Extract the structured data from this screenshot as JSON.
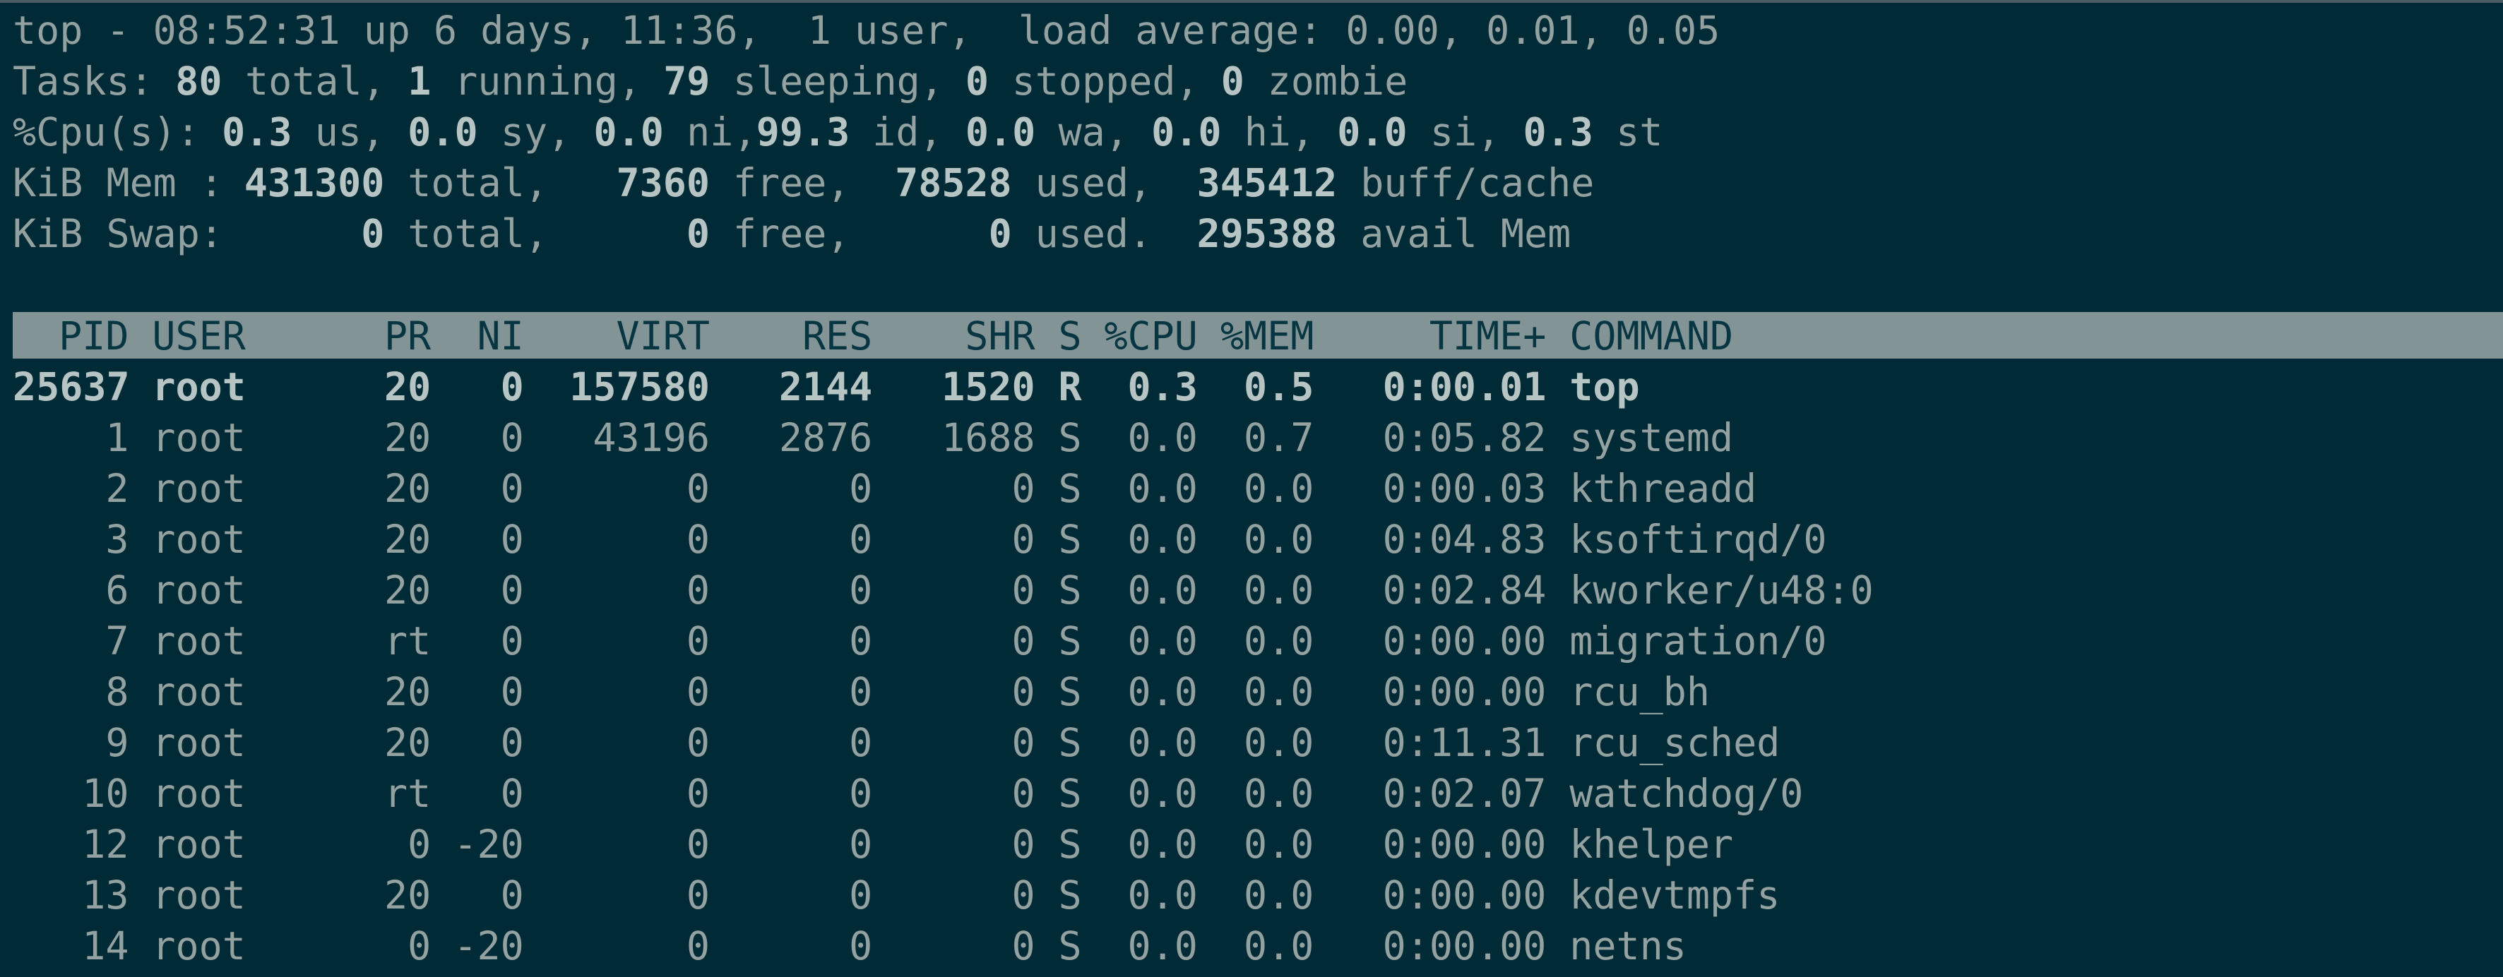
{
  "summary": {
    "line1": "top - 08:52:31 up 6 days, 11:36,  1 user,  load average: 0.00, 0.01, 0.05",
    "tasks": {
      "label": "Tasks:",
      "total": "80",
      "total_lbl": "total,",
      "running": "1",
      "running_lbl": "running,",
      "sleeping": "79",
      "sleeping_lbl": "sleeping,",
      "stopped": "0",
      "stopped_lbl": "stopped,",
      "zombie": "0",
      "zombie_lbl": "zombie"
    },
    "cpu": {
      "label": "%Cpu(s):",
      "us": "0.3",
      "us_lbl": "us,",
      "sy": "0.0",
      "sy_lbl": "sy,",
      "ni": "0.0",
      "ni_lbl": "ni,",
      "id": "99.3",
      "id_lbl": "id,",
      "wa": "0.0",
      "wa_lbl": "wa,",
      "hi": "0.0",
      "hi_lbl": "hi,",
      "si": "0.0",
      "si_lbl": "si,",
      "st": "0.3",
      "st_lbl": "st"
    },
    "mem": {
      "label": "KiB Mem :",
      "total": "431300",
      "total_lbl": "total,",
      "free": "7360",
      "free_lbl": "free,",
      "used": "78528",
      "used_lbl": "used,",
      "buff": "345412",
      "buff_lbl": "buff/cache"
    },
    "swap": {
      "label": "KiB Swap:",
      "total": "0",
      "total_lbl": "total,",
      "free": "0",
      "free_lbl": "free,",
      "used": "0",
      "used_lbl": "used.",
      "avail": "295388",
      "avail_lbl": "avail Mem"
    }
  },
  "columns": [
    "PID",
    "USER",
    "PR",
    "NI",
    "VIRT",
    "RES",
    "SHR",
    "S",
    "%CPU",
    "%MEM",
    "TIME+",
    "COMMAND"
  ],
  "processes": [
    [
      "25637",
      "root",
      "20",
      "0",
      "157580",
      "2144",
      "1520",
      "R",
      "0.3",
      "0.5",
      "0:00.01",
      "top"
    ],
    [
      "1",
      "root",
      "20",
      "0",
      "43196",
      "2876",
      "1688",
      "S",
      "0.0",
      "0.7",
      "0:05.82",
      "systemd"
    ],
    [
      "2",
      "root",
      "20",
      "0",
      "0",
      "0",
      "0",
      "S",
      "0.0",
      "0.0",
      "0:00.03",
      "kthreadd"
    ],
    [
      "3",
      "root",
      "20",
      "0",
      "0",
      "0",
      "0",
      "S",
      "0.0",
      "0.0",
      "0:04.83",
      "ksoftirqd/0"
    ],
    [
      "6",
      "root",
      "20",
      "0",
      "0",
      "0",
      "0",
      "S",
      "0.0",
      "0.0",
      "0:02.84",
      "kworker/u48:0"
    ],
    [
      "7",
      "root",
      "rt",
      "0",
      "0",
      "0",
      "0",
      "S",
      "0.0",
      "0.0",
      "0:00.00",
      "migration/0"
    ],
    [
      "8",
      "root",
      "20",
      "0",
      "0",
      "0",
      "0",
      "S",
      "0.0",
      "0.0",
      "0:00.00",
      "rcu_bh"
    ],
    [
      "9",
      "root",
      "20",
      "0",
      "0",
      "0",
      "0",
      "S",
      "0.0",
      "0.0",
      "0:11.31",
      "rcu_sched"
    ],
    [
      "10",
      "root",
      "rt",
      "0",
      "0",
      "0",
      "0",
      "S",
      "0.0",
      "0.0",
      "0:02.07",
      "watchdog/0"
    ],
    [
      "12",
      "root",
      "0",
      "-20",
      "0",
      "0",
      "0",
      "S",
      "0.0",
      "0.0",
      "0:00.00",
      "khelper"
    ],
    [
      "13",
      "root",
      "20",
      "0",
      "0",
      "0",
      "0",
      "S",
      "0.0",
      "0.0",
      "0:00.00",
      "kdevtmpfs"
    ],
    [
      "14",
      "root",
      "0",
      "-20",
      "0",
      "0",
      "0",
      "S",
      "0.0",
      "0.0",
      "0:00.00",
      "netns"
    ]
  ]
}
